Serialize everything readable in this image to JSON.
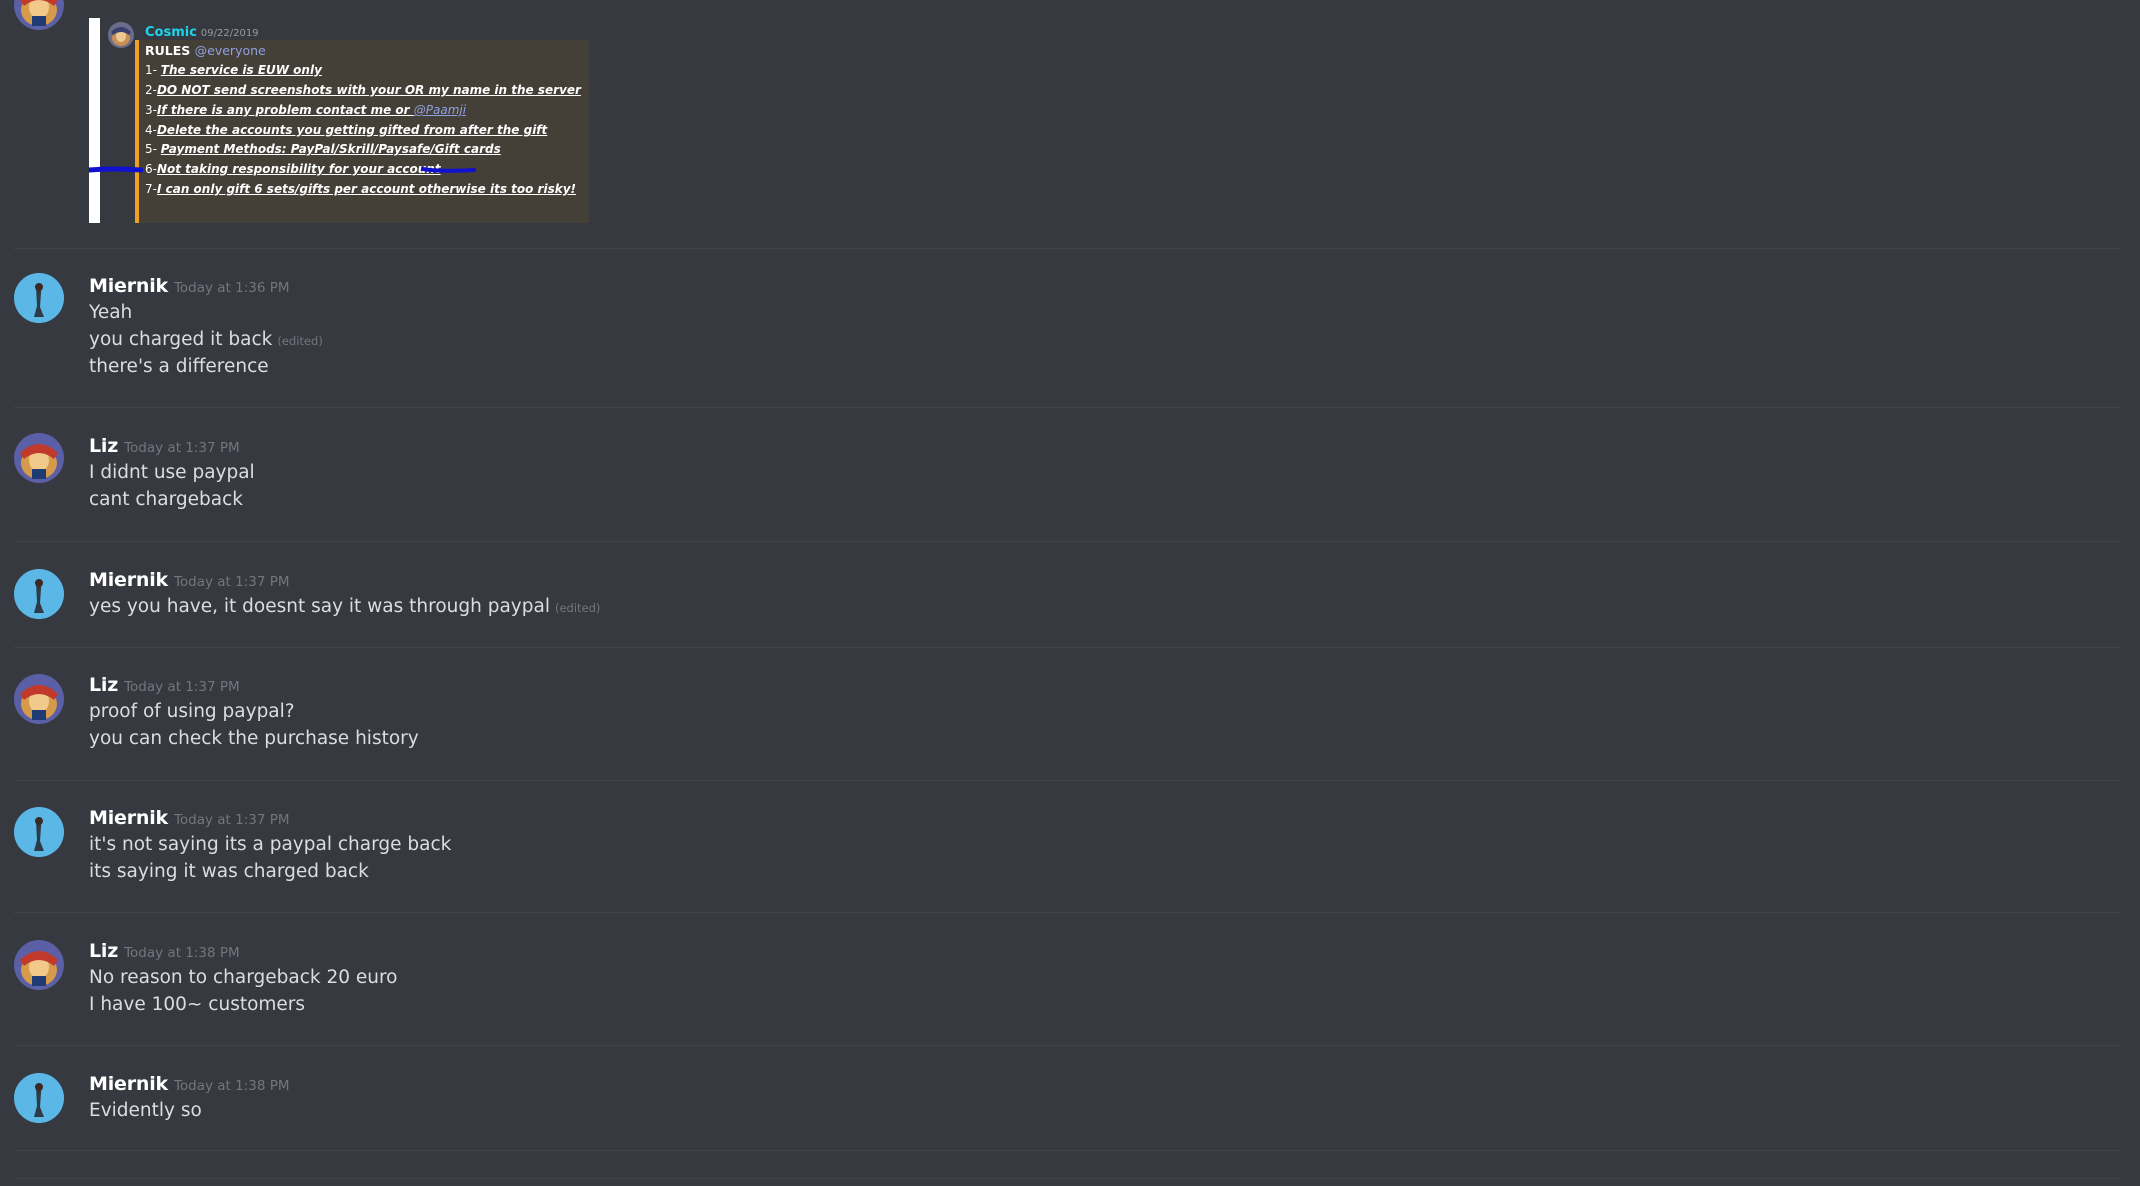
{
  "embed": {
    "author": "Cosmic",
    "date": "09/22/2019",
    "title": "RULES",
    "mention": "@everyone",
    "rules": [
      {
        "num": "1- ",
        "text": "The service is EUW only"
      },
      {
        "num": "2-",
        "text": "DO NOT send screenshots with your OR my name in the server"
      },
      {
        "num": "3-",
        "text": "If there is any problem contact me or ",
        "link": "@Paamji"
      },
      {
        "num": "4-",
        "text": "Delete the accounts you getting gifted from after the gift"
      },
      {
        "num": "5- ",
        "text": "Payment Methods: PayPal/Skrill/Paysafe/Gift cards"
      },
      {
        "num": "6-",
        "text": "Not taking responsibility for your account"
      },
      {
        "num": "7-",
        "text": "I can only gift 6 sets/gifts per account otherwise its too risky!"
      }
    ]
  },
  "messages": [
    {
      "author": "Miernik",
      "timestamp": "Today at 1:36 PM",
      "lines": [
        {
          "text": "Yeah"
        },
        {
          "text": "you charged it back",
          "edited": "(edited)"
        },
        {
          "text": "there's a difference"
        }
      ]
    },
    {
      "author": "Liz",
      "timestamp": "Today at 1:37 PM",
      "lines": [
        {
          "text": "I didnt use paypal"
        },
        {
          "text": "cant chargeback"
        }
      ]
    },
    {
      "author": "Miernik",
      "timestamp": "Today at 1:37 PM",
      "lines": [
        {
          "text": "yes you have, it doesnt say it was through paypal",
          "edited": "(edited)"
        }
      ]
    },
    {
      "author": "Liz",
      "timestamp": "Today at 1:37 PM",
      "lines": [
        {
          "text": "proof of using paypal?"
        },
        {
          "text": "you can check the purchase history"
        }
      ]
    },
    {
      "author": "Miernik",
      "timestamp": "Today at 1:37 PM",
      "lines": [
        {
          "text": "it's not saying its a paypal charge back"
        },
        {
          "text": "its saying it was charged back"
        }
      ]
    },
    {
      "author": "Liz",
      "timestamp": "Today at 1:38 PM",
      "lines": [
        {
          "text": "No reason to chargeback 20 euro"
        },
        {
          "text": "I have 100~ customers"
        }
      ]
    },
    {
      "author": "Miernik",
      "timestamp": "Today at 1:38 PM",
      "lines": [
        {
          "text": "Evidently so"
        }
      ]
    }
  ]
}
